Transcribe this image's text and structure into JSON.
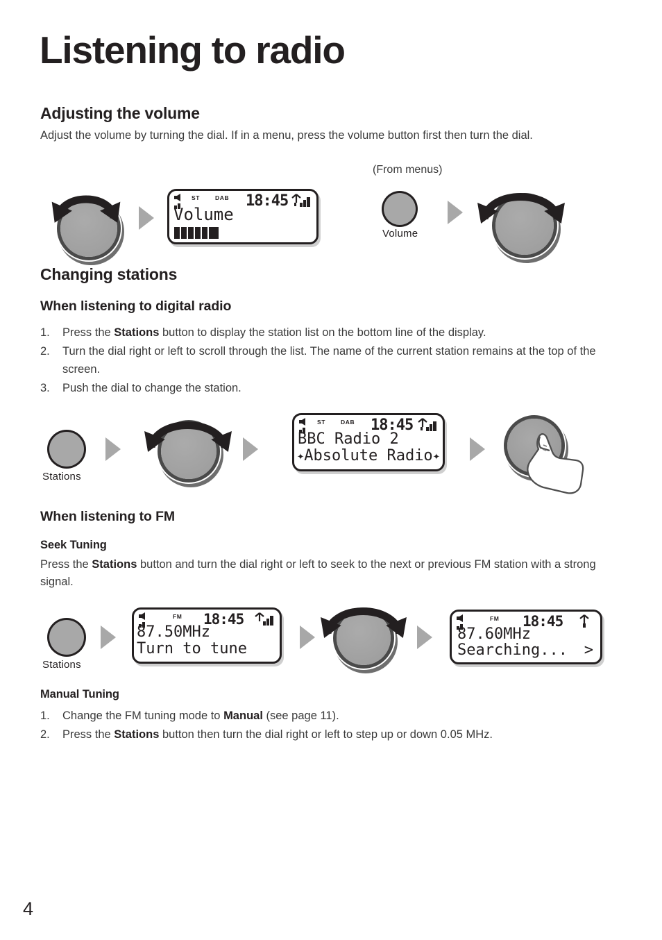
{
  "page": {
    "title": "Listening to radio",
    "number": "4"
  },
  "sections": {
    "volume": {
      "heading": "Adjusting the volume",
      "body": "Adjust the volume by turning the dial. If in a menu, press the volume button first then turn the dial.",
      "from_menus_caption": "(From menus)",
      "volume_button_label": "Volume",
      "lcd": {
        "tag_st": "ST",
        "tag_dab": "DAB",
        "clock": "18:45",
        "line1": "Volume",
        "volume_blocks": 6
      }
    },
    "changing_stations": {
      "heading": "Changing stations",
      "digital": {
        "heading": "When listening to digital radio",
        "steps": [
          {
            "num": "1.",
            "html": "Press the <b>Stations</b> button to display the station list on the bottom line of the display."
          },
          {
            "num": "2.",
            "html": "Turn the dial right or left to scroll through the list. The name of the current station remains at the top of the screen."
          },
          {
            "num": "3.",
            "html": "Push the dial to change the station."
          }
        ],
        "stations_button_label": "Stations",
        "lcd": {
          "tag_st": "ST",
          "tag_dab": "DAB",
          "clock": "18:45",
          "line1": "BBC Radio 2",
          "line2": "Absolute Radio",
          "line2_left_marker": "✦",
          "line2_right_marker": "✦"
        }
      },
      "fm": {
        "heading": "When listening to FM",
        "seek": {
          "heading": "Seek Tuning",
          "body_html": "Press the <b>Stations</b> button and turn the dial right or left to seek to the next or previous FM station with a strong signal.",
          "stations_button_label": "Stations",
          "lcd_before": {
            "tag_fm": "FM",
            "clock": "18:45",
            "line1": "87.50MHz",
            "line2": "Turn to tune"
          },
          "lcd_after": {
            "tag_fm": "FM",
            "clock": "18:45",
            "line1": "87.60MHz",
            "line2": "Searching...",
            "line2_right_marker": ">"
          }
        },
        "manual": {
          "heading": "Manual Tuning",
          "steps": [
            {
              "num": "1.",
              "html": "Change the FM tuning mode to <b>Manual</b> (see page 11)."
            },
            {
              "num": "2.",
              "html": "Press the <b>Stations</b> button then turn the dial right or left to step up or down 0.05 MHz."
            }
          ]
        }
      }
    }
  },
  "colors": {
    "ink": "#231f20",
    "body_text": "#3a3a3a",
    "knob_grey": "#a8a8a8",
    "marker_grey": "#a8a8a8"
  }
}
